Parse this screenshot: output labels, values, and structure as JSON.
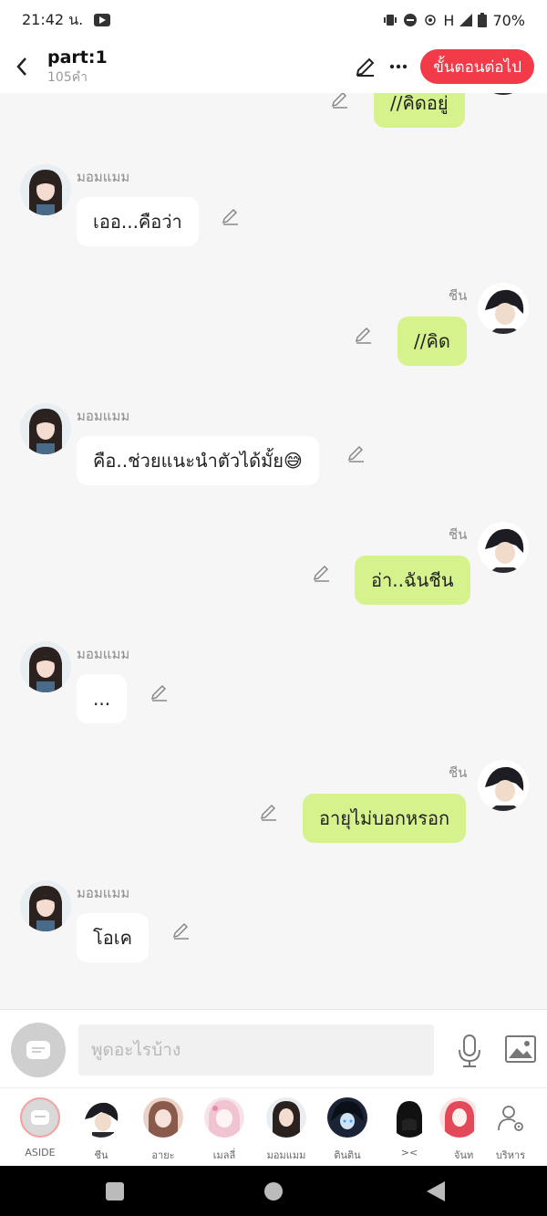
{
  "status": {
    "time": "21:42 น.",
    "network": "H",
    "battery": "70%"
  },
  "header": {
    "title": "part:1",
    "word_count": "105คำ",
    "next_label": "ขั้นตอนต่อไป"
  },
  "messages": [
    {
      "text": "//คิดอยู่",
      "name": ""
    },
    {
      "text": "เออ...คือว่า",
      "name": "มอมแมม"
    },
    {
      "text": "//คิด",
      "name": "ชีน"
    },
    {
      "text": "คือ..ช่วยแนะนำตัวได้มั้ย😅",
      "name": "มอมแมม"
    },
    {
      "text": "อ่า..ฉันชีน",
      "name": "ชีน"
    },
    {
      "text": "...",
      "name": "มอมแมม"
    },
    {
      "text": "อายุไม่บอกหรอก",
      "name": "ชีน"
    },
    {
      "text": "โอเค",
      "name": "มอมแมม"
    }
  ],
  "input": {
    "placeholder": "พูดอะไรบ้าง"
  },
  "characters": [
    {
      "label": "ASIDE"
    },
    {
      "label": "ชีน"
    },
    {
      "label": "อายะ"
    },
    {
      "label": "เมลลี่"
    },
    {
      "label": "มอมแมม"
    },
    {
      "label": "ตินติน"
    },
    {
      "label": "><"
    },
    {
      "label": "จันท"
    },
    {
      "label": "บริหาร"
    }
  ],
  "colors": {
    "accent": "#f23a48",
    "right_bubble": "#d5f28c",
    "left_bubble": "#ffffff",
    "background": "#f6f6f6"
  },
  "icons": [
    "back-icon",
    "edit-icon",
    "more-icon",
    "pencil-icon",
    "aside-icon",
    "mic-icon",
    "image-icon",
    "manage-icon"
  ]
}
